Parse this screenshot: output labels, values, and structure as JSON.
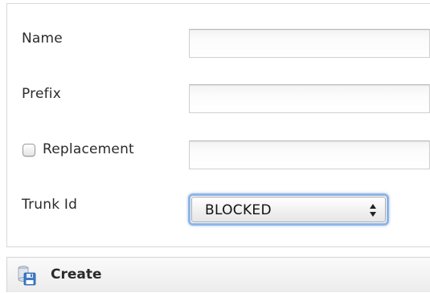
{
  "form": {
    "name_label": "Name",
    "name_value": "",
    "prefix_label": "Prefix",
    "prefix_value": "",
    "replacement_label": "Replacement",
    "replacement_checked": false,
    "replacement_value": "",
    "trunk_label": "Trunk Id",
    "trunk_selected": "BLOCKED"
  },
  "actions": {
    "create_label": "Create",
    "create_icon": "save-disk-icon"
  },
  "colors": {
    "focus_ring": "#8fb4e6",
    "border": "#d9d9d9"
  }
}
